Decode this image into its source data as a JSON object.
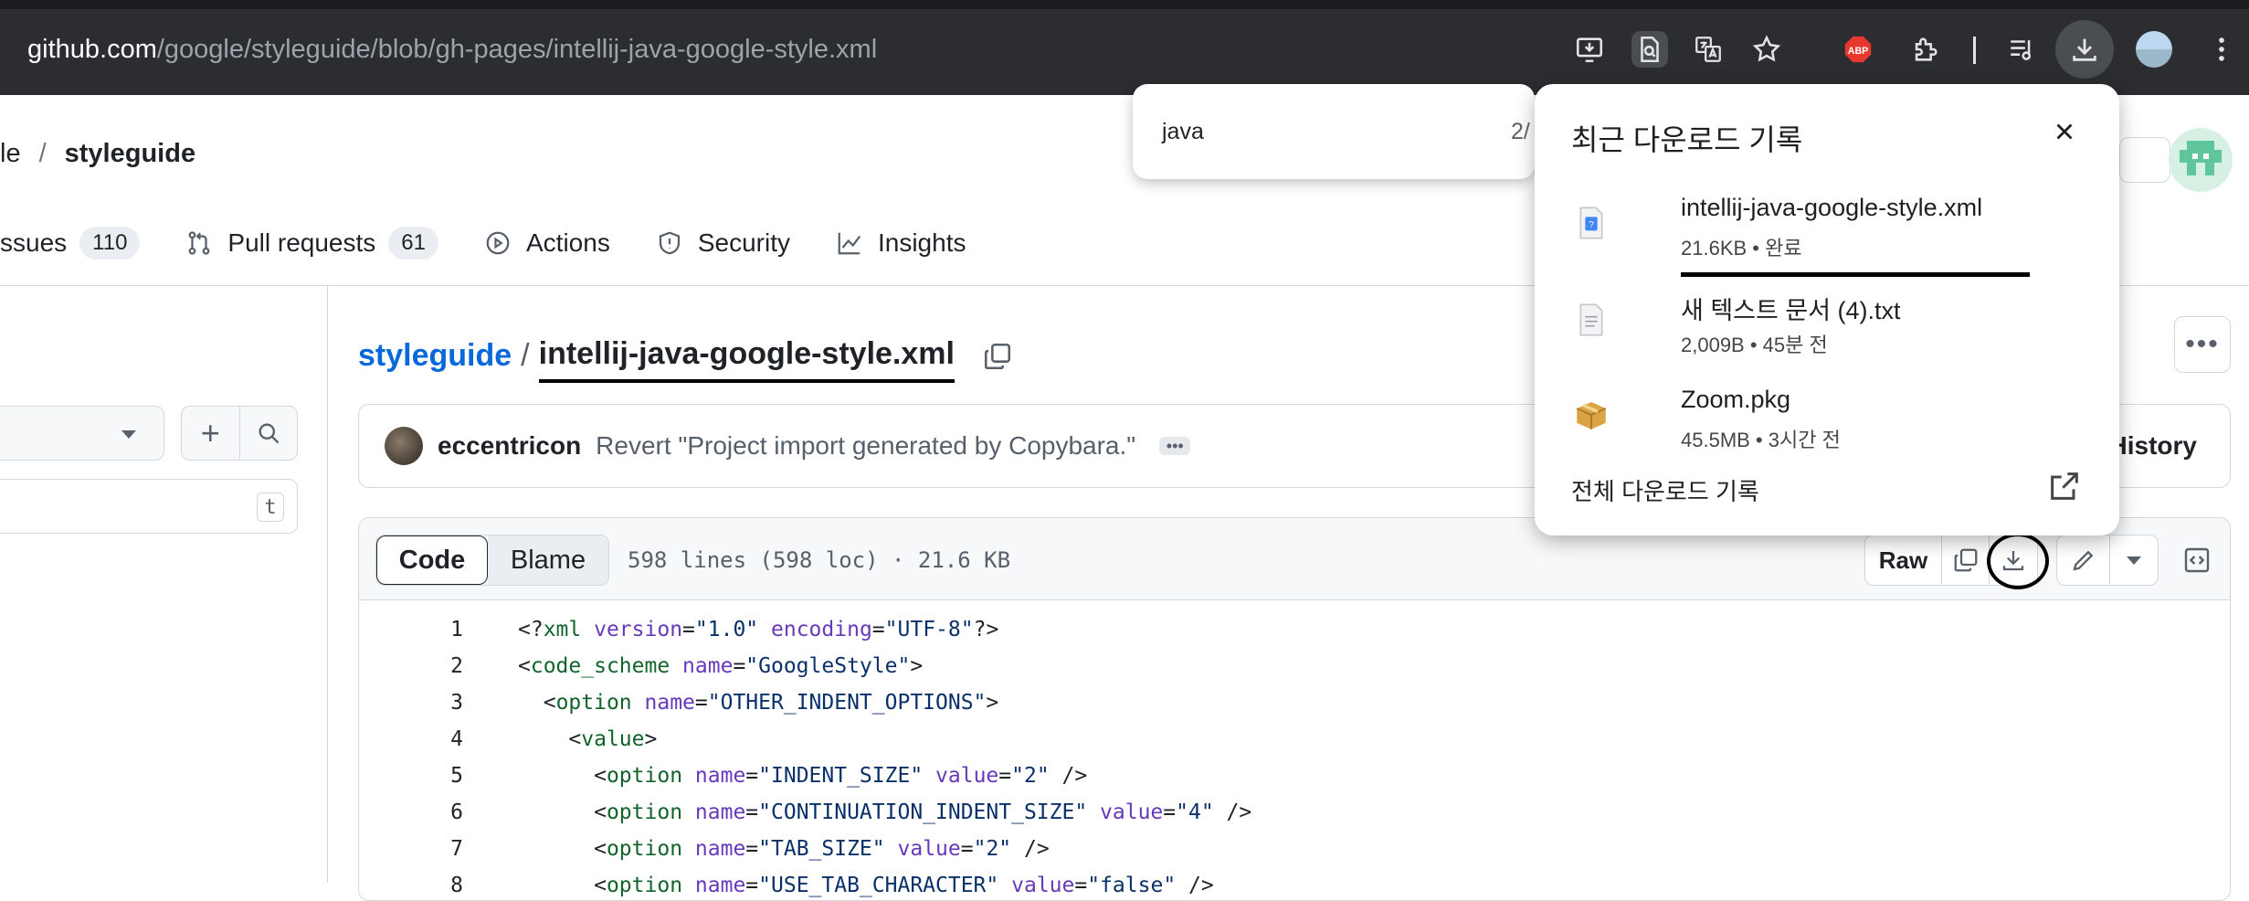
{
  "browser": {
    "url_host": "github.com",
    "url_path": "/google/styleguide/blob/gh-pages/intellij-java-google-style.xml",
    "abp_label": "ABP",
    "icons": [
      "install-app-icon",
      "page-search-icon",
      "translate-icon",
      "bookmark-star-icon",
      "adblock-icon",
      "extensions-icon",
      "media-control-icon",
      "download-icon",
      "profile-avatar-icon",
      "menu-kebab-icon"
    ]
  },
  "repo": {
    "owner_fragment": "le",
    "separator": "/",
    "name": "styleguide"
  },
  "tabs": [
    {
      "label": "ssues",
      "count": "110",
      "icon": "issues-icon"
    },
    {
      "label": "Pull requests",
      "count": "61",
      "icon": "pull-request-icon"
    },
    {
      "label": "Actions",
      "count": "",
      "icon": "actions-play-icon"
    },
    {
      "label": "Security",
      "count": "",
      "icon": "shield-icon"
    },
    {
      "label": "Insights",
      "count": "",
      "icon": "graph-icon"
    }
  ],
  "sidebar": {
    "filter_shortcut": "t"
  },
  "breadcrumb": {
    "repo_link": "styleguide",
    "separator": "/",
    "file": "intellij-java-google-style.xml"
  },
  "commit": {
    "author": "eccentricon",
    "message": "Revert \"Project import generated by Copybara.\"",
    "ellipsis": "•••",
    "history_label": "History"
  },
  "file": {
    "tab_code": "Code",
    "tab_blame": "Blame",
    "meta": "598 lines (598 loc) · 21.6 KB",
    "raw_label": "Raw",
    "lines": [
      {
        "n": "1",
        "indent": "",
        "parts": [
          [
            "p",
            "<?"
          ],
          [
            "tg",
            "xml"
          ],
          [
            "p",
            " "
          ],
          [
            "at",
            "version"
          ],
          [
            "p",
            "="
          ],
          [
            "st",
            "\"1.0\""
          ],
          [
            "p",
            " "
          ],
          [
            "at",
            "encoding"
          ],
          [
            "p",
            "="
          ],
          [
            "st",
            "\"UTF-8\""
          ],
          [
            "p",
            "?>"
          ]
        ]
      },
      {
        "n": "2",
        "indent": "",
        "parts": [
          [
            "p",
            "<"
          ],
          [
            "tg",
            "code_scheme"
          ],
          [
            "p",
            " "
          ],
          [
            "at",
            "name"
          ],
          [
            "p",
            "="
          ],
          [
            "st",
            "\"GoogleStyle\""
          ],
          [
            "p",
            ">"
          ]
        ]
      },
      {
        "n": "3",
        "indent": "  ",
        "parts": [
          [
            "p",
            "<"
          ],
          [
            "tg",
            "option"
          ],
          [
            "p",
            " "
          ],
          [
            "at",
            "name"
          ],
          [
            "p",
            "="
          ],
          [
            "st",
            "\"OTHER_INDENT_OPTIONS\""
          ],
          [
            "p",
            ">"
          ]
        ]
      },
      {
        "n": "4",
        "indent": "    ",
        "parts": [
          [
            "p",
            "<"
          ],
          [
            "tg",
            "value"
          ],
          [
            "p",
            ">"
          ]
        ]
      },
      {
        "n": "5",
        "indent": "      ",
        "parts": [
          [
            "p",
            "<"
          ],
          [
            "tg",
            "option"
          ],
          [
            "p",
            " "
          ],
          [
            "at",
            "name"
          ],
          [
            "p",
            "="
          ],
          [
            "st",
            "\"INDENT_SIZE\""
          ],
          [
            "p",
            " "
          ],
          [
            "at",
            "value"
          ],
          [
            "p",
            "="
          ],
          [
            "st",
            "\"2\""
          ],
          [
            "p",
            " />"
          ]
        ]
      },
      {
        "n": "6",
        "indent": "      ",
        "parts": [
          [
            "p",
            "<"
          ],
          [
            "tg",
            "option"
          ],
          [
            "p",
            " "
          ],
          [
            "at",
            "name"
          ],
          [
            "p",
            "="
          ],
          [
            "st",
            "\"CONTINUATION_INDENT_SIZE\""
          ],
          [
            "p",
            " "
          ],
          [
            "at",
            "value"
          ],
          [
            "p",
            "="
          ],
          [
            "st",
            "\"4\""
          ],
          [
            "p",
            " />"
          ]
        ]
      },
      {
        "n": "7",
        "indent": "      ",
        "parts": [
          [
            "p",
            "<"
          ],
          [
            "tg",
            "option"
          ],
          [
            "p",
            " "
          ],
          [
            "at",
            "name"
          ],
          [
            "p",
            "="
          ],
          [
            "st",
            "\"TAB_SIZE\""
          ],
          [
            "p",
            " "
          ],
          [
            "at",
            "value"
          ],
          [
            "p",
            "="
          ],
          [
            "st",
            "\"2\""
          ],
          [
            "p",
            " />"
          ]
        ]
      },
      {
        "n": "8",
        "indent": "      ",
        "parts": [
          [
            "p",
            "<"
          ],
          [
            "tg",
            "option"
          ],
          [
            "p",
            " "
          ],
          [
            "at",
            "name"
          ],
          [
            "p",
            "="
          ],
          [
            "st",
            "\"USE_TAB_CHARACTER\""
          ],
          [
            "p",
            " "
          ],
          [
            "at",
            "value"
          ],
          [
            "p",
            "="
          ],
          [
            "st",
            "\"false\""
          ],
          [
            "p",
            " />"
          ]
        ]
      }
    ]
  },
  "find_bar": {
    "query": "java",
    "count": "2/"
  },
  "downloads": {
    "title": "최근 다운로드 기록",
    "items": [
      {
        "name": "intellij-java-google-style.xml",
        "detail": "21.6KB • 완료",
        "icon": "xml-file-icon"
      },
      {
        "name": "새 텍스트 문서 (4).txt",
        "detail": "2,009B • 45분 전",
        "icon": "text-file-icon"
      },
      {
        "name": "Zoom.pkg",
        "detail": "45.5MB • 3시간 전",
        "icon": "package-icon"
      }
    ],
    "footer": "전체 다운로드 기록"
  }
}
